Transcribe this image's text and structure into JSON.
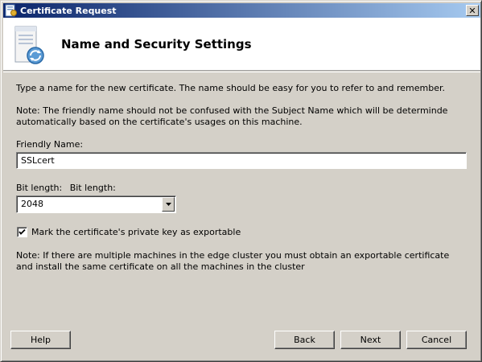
{
  "window": {
    "title": "Certificate Request",
    "close_glyph": "✕"
  },
  "header": {
    "title": "Name and Security Settings",
    "icon": "certificate-server-icon"
  },
  "body": {
    "intro": "Type a name for the new certificate. The name should be easy for you to refer to and remember.",
    "note1": "Note: The friendly name should not be confused with the Subject Name which will be determinde automatically based on the certificate's usages on this machine.",
    "friendly_name_label": "Friendly Name:",
    "friendly_name_value": "SSLcert",
    "bit_length_label_1": "Bit length:",
    "bit_length_label_2": "Bit length:",
    "bit_length_value": "2048",
    "exportable_label": "Mark the certificate's private key as exportable",
    "exportable_checked": true,
    "note2": "Note: If there are multiple machines in the edge cluster you must obtain an exportable certificate and install the same certificate on all the machines in the cluster"
  },
  "buttons": {
    "help": "Help",
    "back": "Back",
    "next": "Next",
    "cancel": "Cancel"
  },
  "colors": {
    "title_gradient_start": "#0a246a",
    "title_gradient_end": "#a6caf0",
    "dialog_face": "#d4d0c8"
  }
}
